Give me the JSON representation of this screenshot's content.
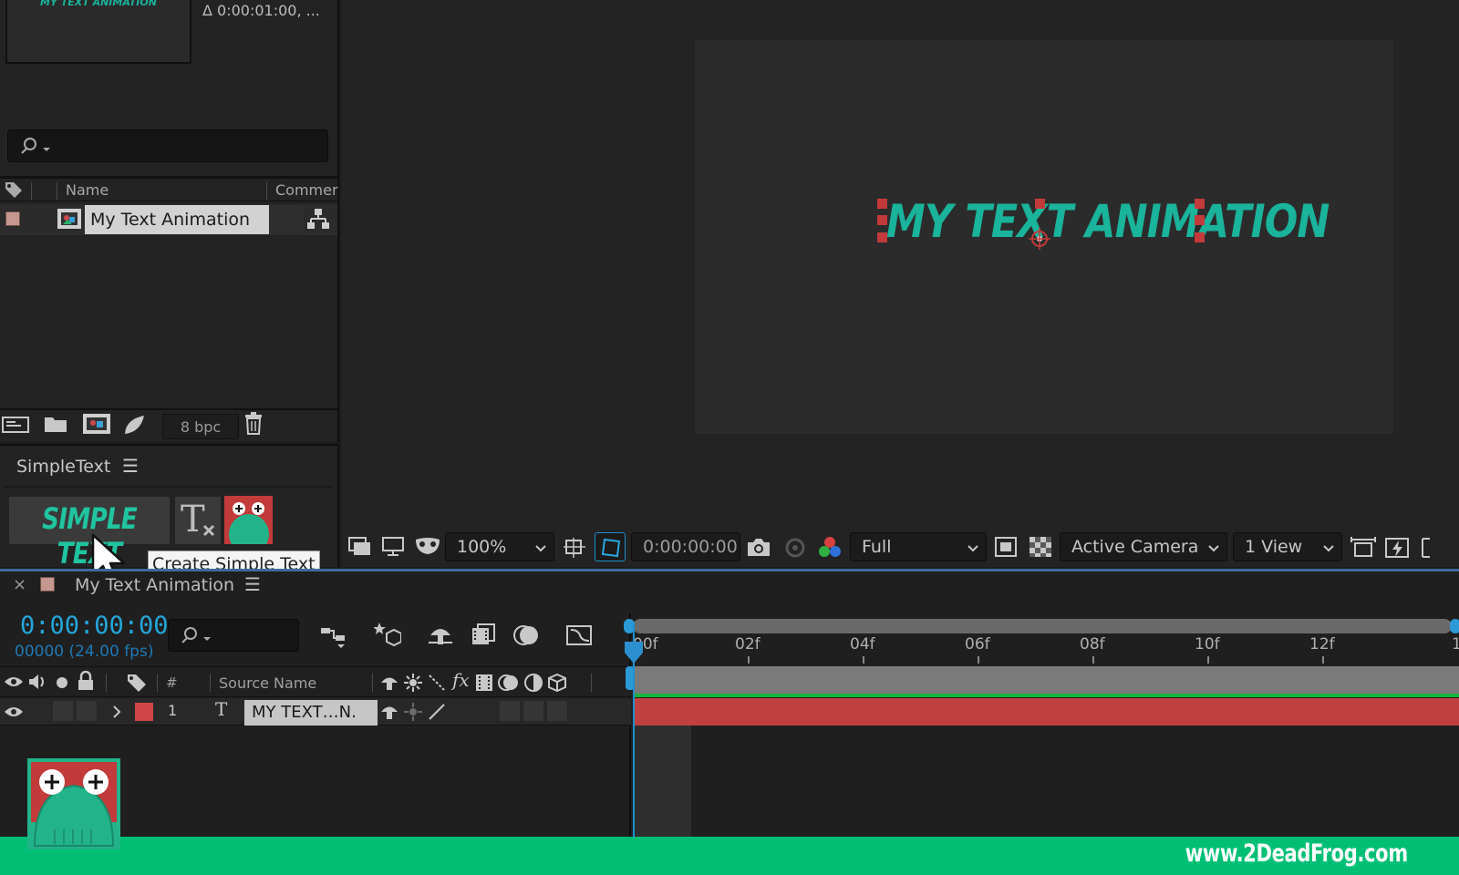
{
  "project": {
    "thumbnail_text": "MY TEXT ANIMATION",
    "delta_text": "Δ 0:00:01:00, ...",
    "columns": {
      "name": "Name",
      "comment": "Commer"
    },
    "items": [
      {
        "name": "My Text Animation"
      }
    ],
    "bpc": "8 bpc"
  },
  "simpletext": {
    "title": "SimpleText",
    "menu_glyph": "☰",
    "logo_text": "SIMPLE TEXT",
    "clear_glyph": "T",
    "tooltip": "Create Simple Text"
  },
  "viewer": {
    "comp_text": "MY TEXT ANIMATION",
    "zoom": "100%",
    "timecode": "0:00:00:00",
    "resolution": "Full",
    "camera": "Active Camera",
    "views": "1 View"
  },
  "timeline": {
    "close_glyph": "×",
    "tab_name": "My Text Animation",
    "menu_glyph": "☰",
    "time": "0:00:00:00",
    "fps": "00000 (24.00 fps)",
    "headers": {
      "number": "#",
      "source_name": "Source Name",
      "fx": "fx"
    },
    "layers": [
      {
        "index": "1",
        "type_glyph": "T",
        "name": "MY TEXT…N."
      }
    ],
    "ticks": [
      "00f",
      "02f",
      "04f",
      "06f",
      "08f",
      "10f",
      "12f",
      "1"
    ]
  },
  "footer": {
    "url": "www.2DeadFrog.com"
  },
  "colors": {
    "accent_teal": "#1ab39b",
    "timeline_blue": "#23a6d9",
    "brand_green": "#00bf74",
    "layer_red": "#c04040"
  }
}
